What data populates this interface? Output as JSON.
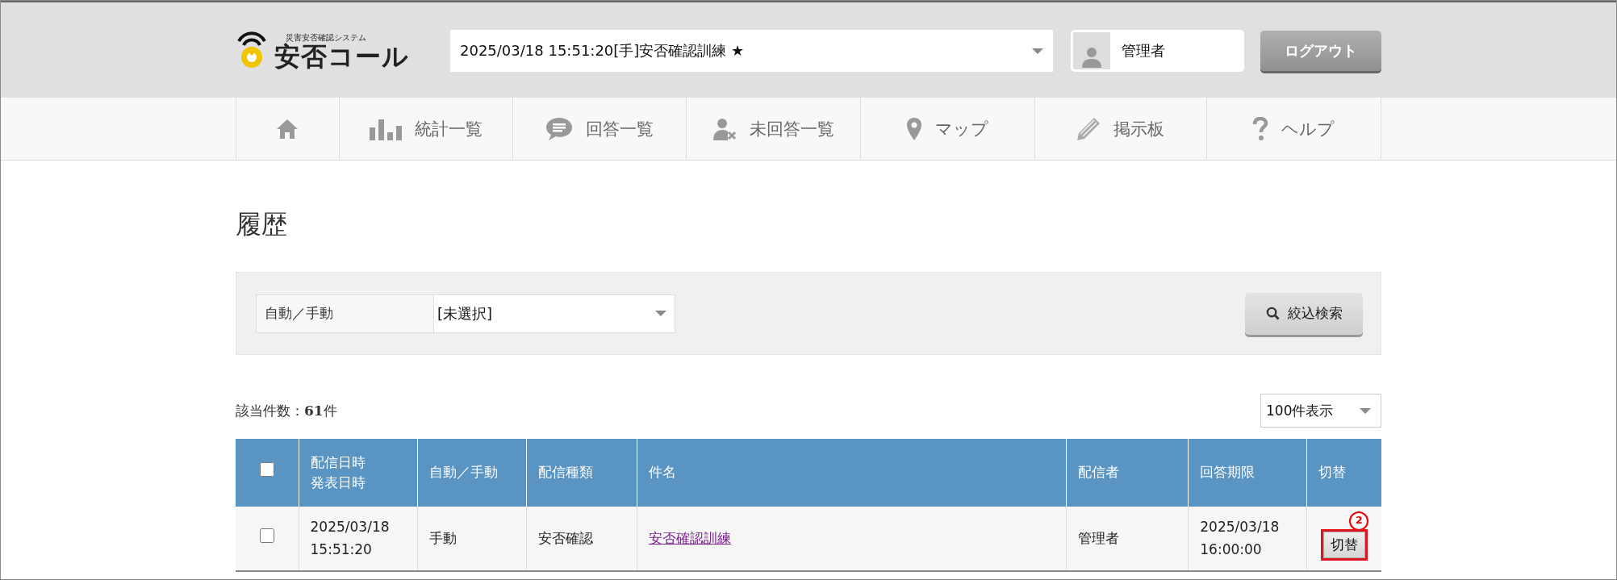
{
  "header": {
    "logo": {
      "subtitle": "災害安否確認システム",
      "name": "安否コール"
    },
    "event_select": {
      "value": "2025/03/18 15:51:20[手]安否確認訓練 ★"
    },
    "user": {
      "name": "管理者"
    },
    "logout_button": "ログアウト"
  },
  "nav": [
    {
      "label": "統計一覧"
    },
    {
      "label": "回答一覧"
    },
    {
      "label": "未回答一覧"
    },
    {
      "label": "マップ"
    },
    {
      "label": "掲示板"
    },
    {
      "label": "ヘルプ"
    }
  ],
  "page_title": "履歴",
  "filter": {
    "label": "自動／手動",
    "select_value": "[未選択]",
    "search_button": "絞込検索"
  },
  "result_count": {
    "label": "該当件数：",
    "count": "61",
    "unit": "件"
  },
  "page_size": "100件表示",
  "table": {
    "select_all_checked": false,
    "columns": [
      [
        "配信日時",
        "発表日時"
      ],
      [
        "自動／手動"
      ],
      [
        "配信種類"
      ],
      [
        "件名"
      ],
      [
        "配信者"
      ],
      [
        "回答期限"
      ],
      [
        "切替"
      ]
    ],
    "rows": [
      {
        "checked": false,
        "datetime": [
          "2025/03/18",
          "15:51:20"
        ],
        "mode": "手動",
        "type": "安否確認",
        "subject": "安否確認訓練",
        "sender": "管理者",
        "deadline": [
          "2025/03/18",
          "16:00:00"
        ],
        "switch_button": "切替",
        "annotation": "2"
      }
    ]
  }
}
